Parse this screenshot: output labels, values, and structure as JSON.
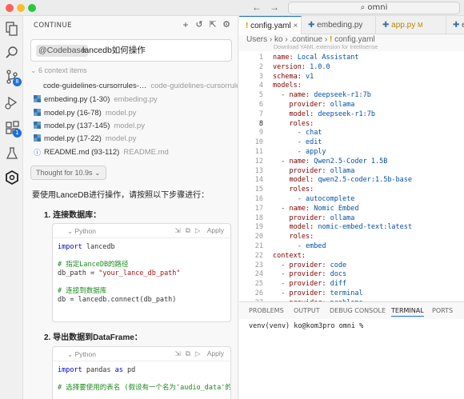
{
  "titlebar": {
    "search_text": "omni"
  },
  "activity": {
    "source_control_badge": "8",
    "extensions_badge": "1"
  },
  "chat": {
    "title": "CONTINUE",
    "query_tag": "@Codebase",
    "query_text": "lancedb如何操作",
    "context_header": "6 context items",
    "context_items": [
      {
        "name": "code-guidelines-cursorrules-…",
        "path": "code-guidelines-cursorrules…"
      },
      {
        "name": "embeding.py (1-30)",
        "path": "embeding.py"
      },
      {
        "name": "model.py (16-78)",
        "path": "model.py"
      },
      {
        "name": "model.py (137-145)",
        "path": "model.py"
      },
      {
        "name": "model.py (17-22)",
        "path": "model.py"
      },
      {
        "name": "README.md (93-112)",
        "path": "README.md"
      }
    ],
    "thought_label": "Thought for 10.9s",
    "intro": "要使用LanceDB进行操作，请按照以下步骤进行：",
    "steps": [
      {
        "label": "1. 连接数据库："
      },
      {
        "label": "2. 导出数据到DataFrame："
      }
    ],
    "code_lang": "Python",
    "apply_label": "Apply",
    "code1": {
      "l1_kw": "import",
      "l1_mod": " lancedb",
      "l3": "# 指定LanceDB的路径",
      "l4_pre": "db_path = ",
      "l4_str": "\"your_lance_db_path\"",
      "l6": "# 连接到数据库",
      "l7": "db = lancedb.connect(db_path)"
    },
    "code2": {
      "l1_kw": "import",
      "l1_mod": " pandas ",
      "l1_as": "as",
      "l1_alias": " pd",
      "l3": "# 选择要使用的表名 (假设有一个名为'audio_data'的表)"
    }
  },
  "tabs": [
    {
      "label": "config.yaml",
      "prefix": "!"
    },
    {
      "label": "embeding.py"
    },
    {
      "label": "app.py",
      "modified": "M"
    },
    {
      "label": "e"
    }
  ],
  "breadcrumb": [
    "Users",
    "ko",
    ".continue",
    "config.yaml"
  ],
  "editor_hint": "Download YAML extension for Intellisense",
  "yaml_lines": [
    [
      "name",
      "Local Assistant"
    ],
    [
      "version",
      "1.0.0"
    ],
    [
      "schema",
      "v1"
    ],
    [
      "models",
      ""
    ],
    [
      "  - name",
      "deepseek-r1:7b"
    ],
    [
      "    provider",
      "ollama"
    ],
    [
      "    model",
      "deepseek-r1:7b"
    ],
    [
      "    roles",
      ""
    ],
    [
      "      - ",
      "chat"
    ],
    [
      "      - ",
      "edit"
    ],
    [
      "      - ",
      "apply"
    ],
    [
      "  - name",
      "Qwen2.5-Coder 1.5B"
    ],
    [
      "    provider",
      "ollama"
    ],
    [
      "    model",
      "qwen2.5-coder:1.5b-base"
    ],
    [
      "    roles",
      ""
    ],
    [
      "      - ",
      "autocomplete"
    ],
    [
      "  - name",
      "Nomic Embed"
    ],
    [
      "    provider",
      "ollama"
    ],
    [
      "    model",
      "nomic-embed-text:latest"
    ],
    [
      "    roles",
      ""
    ],
    [
      "      - ",
      "embed"
    ],
    [
      "context",
      ""
    ],
    [
      "  - provider",
      "code"
    ],
    [
      "  - provider",
      "docs"
    ],
    [
      "  - provider",
      "diff"
    ],
    [
      "  - provider",
      "terminal"
    ],
    [
      "  - provider",
      "problems"
    ]
  ],
  "panel_tabs": [
    "PROBLEMS",
    "OUTPUT",
    "DEBUG CONSOLE",
    "TERMINAL",
    "PORTS"
  ],
  "terminal_line": "venv(venv) ko@kom3pro omni %",
  "colors": {
    "accent": "#1e6fd9",
    "yaml_key": "#800000",
    "yaml_value": "#0451a5"
  }
}
